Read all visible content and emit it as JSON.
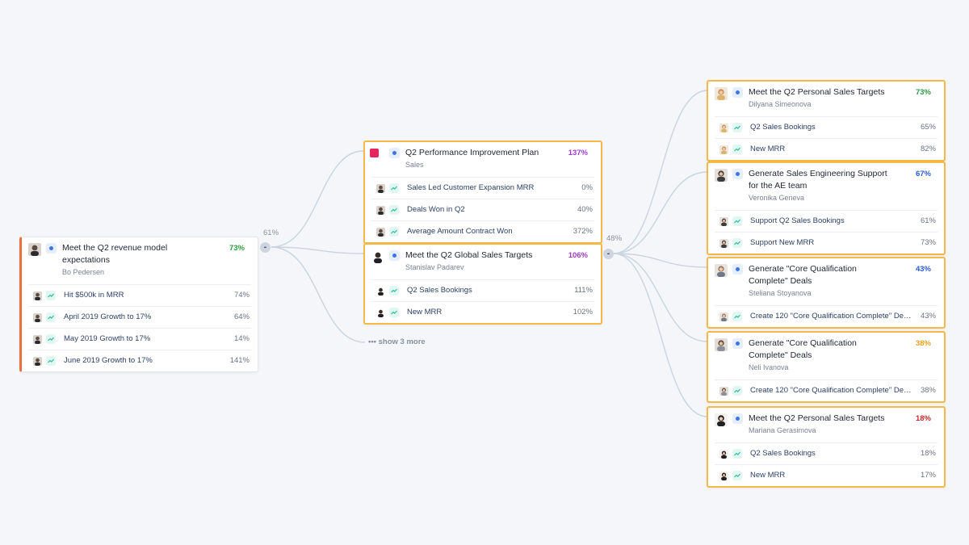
{
  "colors": {
    "accent_orange": "#f5b94a",
    "pct_green": "#2e9b3d",
    "pct_purple": "#a23bc7",
    "pct_blue": "#2a5bd6",
    "pct_orange": "#f0a020",
    "pct_red": "#c8262e",
    "link": "#c9d4e3"
  },
  "root": {
    "title": "Meet the Q2 revenue model expectations",
    "owner": "Bo Pedersen",
    "progress": "73%",
    "key_results": [
      {
        "label": "Hit $500k in MRR",
        "progress": "74%"
      },
      {
        "label": "April 2019 Growth to 17%",
        "progress": "64%"
      },
      {
        "label": "May 2019 Growth to 17%",
        "progress": "14%"
      },
      {
        "label": "June 2019 Growth to 17%",
        "progress": "141%"
      }
    ],
    "children_progress": "61%",
    "toggle": "-"
  },
  "middle": [
    {
      "title": "Q2 Performance Improvement Plan",
      "owner": "Sales",
      "progress": "137%",
      "icon": "red-square-icon",
      "key_results": [
        {
          "label": "Sales Led Customer Expansion MRR",
          "progress": "0%"
        },
        {
          "label": "Deals Won in Q2",
          "progress": "40%"
        },
        {
          "label": "Average Amount Contract Won",
          "progress": "372%"
        }
      ]
    },
    {
      "title": "Meet the Q2 Global Sales Targets",
      "owner": "Stanislav Padarev",
      "progress": "106%",
      "key_results": [
        {
          "label": "Q2 Sales Bookings",
          "progress": "111%"
        },
        {
          "label": "New MRR",
          "progress": "102%"
        }
      ],
      "children_progress": "48%",
      "toggle": "-"
    }
  ],
  "show_more": "••• show 3 more",
  "right": [
    {
      "title": "Meet the Q2 Personal Sales Targets",
      "owner": "Dilyana Simeonova",
      "progress": "73%",
      "key_results": [
        {
          "label": "Q2 Sales Bookings",
          "progress": "65%"
        },
        {
          "label": "New MRR",
          "progress": "82%"
        }
      ]
    },
    {
      "title": "Generate Sales Engineering Support for the AE team",
      "owner": "Veronika Geneva",
      "progress": "67%",
      "key_results": [
        {
          "label": "Support Q2 Sales Bookings",
          "progress": "61%"
        },
        {
          "label": "Support New MRR",
          "progress": "73%"
        }
      ]
    },
    {
      "title": "Generate \"Core Qualification Complete\" Deals",
      "owner": "Steliana Stoyanova",
      "progress": "43%",
      "key_results": [
        {
          "label": "Create 120 \"Core Qualification Complete\" Deal...",
          "progress": "43%"
        }
      ]
    },
    {
      "title": "Generate \"Core Qualification Complete\" Deals",
      "owner": "Neli Ivanova",
      "progress": "38%",
      "key_results": [
        {
          "label": "Create 120 \"Core Qualification Complete\" Deal...",
          "progress": "38%"
        }
      ]
    },
    {
      "title": "Meet the Q2 Personal Sales Targets",
      "owner": "Mariana Gerasimova",
      "progress": "18%",
      "key_results": [
        {
          "label": "Q2 Sales Bookings",
          "progress": "18%"
        },
        {
          "label": "New MRR",
          "progress": "17%"
        }
      ]
    }
  ]
}
